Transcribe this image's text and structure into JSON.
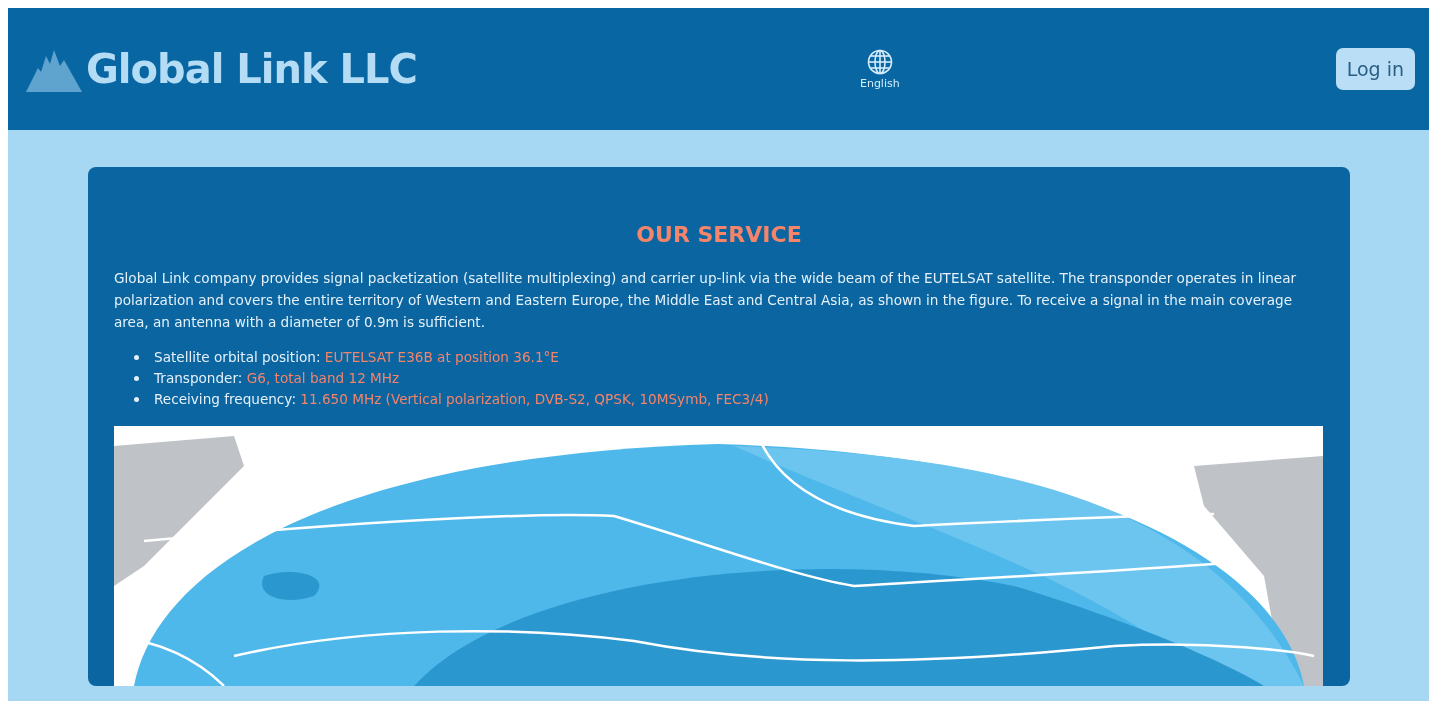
{
  "header": {
    "brand": "Global Link LLC",
    "language": "English",
    "login_button": "Log in"
  },
  "service": {
    "title": "OUR SERVICE",
    "description": "Global Link company provides signal packetization (satellite multiplexing) and carrier up-link via the wide beam of the EUTELSAT satellite. The transponder operates in linear polarization and covers the entire territory of Western and Eastern Europe, the Middle East and Central Asia, as shown in the figure. To receive a signal in the main coverage area, an antenna with a diameter of 0.9m is sufficient.",
    "facts": [
      {
        "label": "Satellite orbital position:",
        "value": "EUTELSAT E36B at position 36.1°E"
      },
      {
        "label": "Transponder:",
        "value": "G6, total band 12 MHz"
      },
      {
        "label": "Receiving frequency:",
        "value": "11.650 MHz (Vertical polarization, DVB-S2, QPSK, 10MSymb, FEC3/4)"
      }
    ]
  }
}
